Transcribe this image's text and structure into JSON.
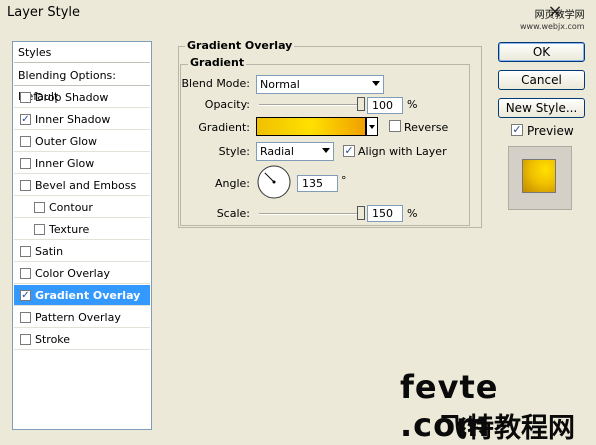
{
  "window": {
    "title": "Layer Style",
    "close_glyph": "×",
    "watermark_top_line1": "网页教学网",
    "watermark_top_line2": "www.webjx.com"
  },
  "styles_panel": {
    "header": "Styles",
    "blending": "Blending Options: Default",
    "items": [
      {
        "label": "Drop Shadow",
        "checked": false
      },
      {
        "label": "Inner Shadow",
        "checked": true
      },
      {
        "label": "Outer Glow",
        "checked": false
      },
      {
        "label": "Inner Glow",
        "checked": false
      },
      {
        "label": "Bevel and Emboss",
        "checked": false
      },
      {
        "label": "Contour",
        "checked": false
      },
      {
        "label": "Texture",
        "checked": false
      },
      {
        "label": "Satin",
        "checked": false
      },
      {
        "label": "Color Overlay",
        "checked": false
      },
      {
        "label": "Gradient Overlay",
        "checked": true
      },
      {
        "label": "Pattern Overlay",
        "checked": false
      },
      {
        "label": "Stroke",
        "checked": false
      }
    ]
  },
  "gradient_overlay": {
    "title": "Gradient Overlay",
    "section": "Gradient",
    "blend_mode_label": "Blend Mode:",
    "blend_mode_value": "Normal",
    "opacity_label": "Opacity:",
    "opacity_value": "100",
    "opacity_fraction": 1.0,
    "gradient_label": "Gradient:",
    "gradient_colors": [
      "#f0c000",
      "#ffe000",
      "#f0a000"
    ],
    "reverse_label": "Reverse",
    "reverse_checked": false,
    "style_label": "Style:",
    "style_value": "Radial",
    "align_label": "Align with Layer",
    "align_checked": true,
    "angle_label": "Angle:",
    "angle_value": "135",
    "angle_unit": "°",
    "scale_label": "Scale:",
    "scale_value": "150",
    "scale_fraction": 1.0,
    "percent": "%"
  },
  "buttons": {
    "ok": "OK",
    "cancel": "Cancel",
    "new_style": "New Style...",
    "preview_label": "Preview",
    "preview_checked": true
  },
  "watermark_bottom": {
    "line1": "fevte .com",
    "line2": "飞特教程网"
  },
  "icons": {
    "checkmark": "✓",
    "dropdown": "chevron-down-icon",
    "angle_dial": "angle-dial-icon"
  }
}
